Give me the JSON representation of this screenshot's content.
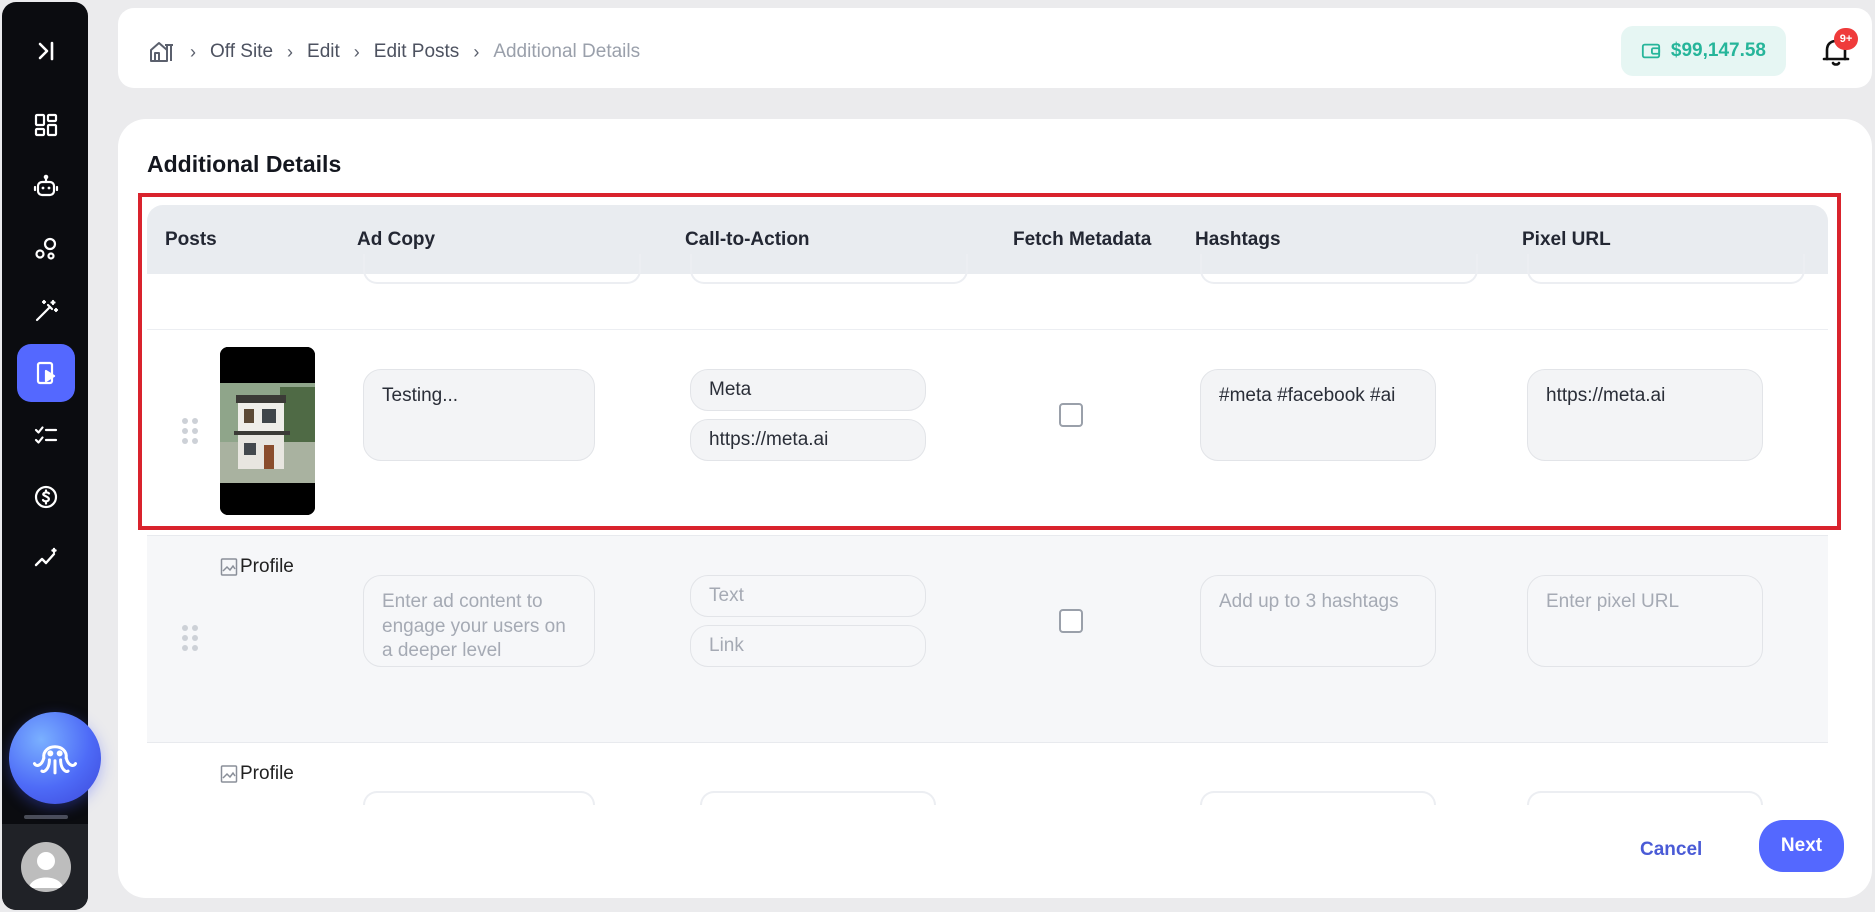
{
  "breadcrumb": {
    "items": [
      "Off Site",
      "Edit",
      "Edit Posts"
    ],
    "current": "Additional Details"
  },
  "wallet": {
    "balance": "$99,147.58"
  },
  "notifications": {
    "badge": "9+"
  },
  "page": {
    "title": "Additional Details"
  },
  "table": {
    "headers": [
      "Posts",
      "Ad Copy",
      "Call-to-Action",
      "Fetch Metadata",
      "Hashtags",
      "Pixel URL"
    ],
    "rows": [
      {
        "ad_copy": "Testing...",
        "cta_text": "Meta",
        "cta_link": "https://meta.ai",
        "fetch_metadata": false,
        "hashtags": "#meta #facebook #ai",
        "pixel_url": "https://meta.ai"
      },
      {
        "image_alt": "Profile",
        "ad_copy_placeholder": "Enter ad content to engage your users on a deeper level",
        "cta_text_placeholder": "Text",
        "cta_link_placeholder": "Link",
        "fetch_metadata": false,
        "hashtags_placeholder": "Add up to 3 hashtags",
        "pixel_url_placeholder": "Enter pixel URL"
      },
      {
        "image_alt": "Profile"
      }
    ]
  },
  "actions": {
    "cancel": "Cancel",
    "next": "Next"
  },
  "colors": {
    "accent": "#5468ff",
    "sidebar": "#0b0c10",
    "wallet_text": "#26b59a",
    "wallet_bg": "#e6f6f3",
    "highlight": "#d9232d",
    "badge": "#ef3b3b"
  },
  "icons": {
    "sidebar": [
      "collapse-icon",
      "dashboard-icon",
      "bot-icon",
      "bubbles-icon",
      "magic-wand-icon",
      "video-post-icon",
      "checklist-icon",
      "dollar-icon",
      "analytics-icon"
    ],
    "assistant": "octopus-icon",
    "header": [
      "home-icon",
      "wallet-icon",
      "bell-icon"
    ]
  }
}
